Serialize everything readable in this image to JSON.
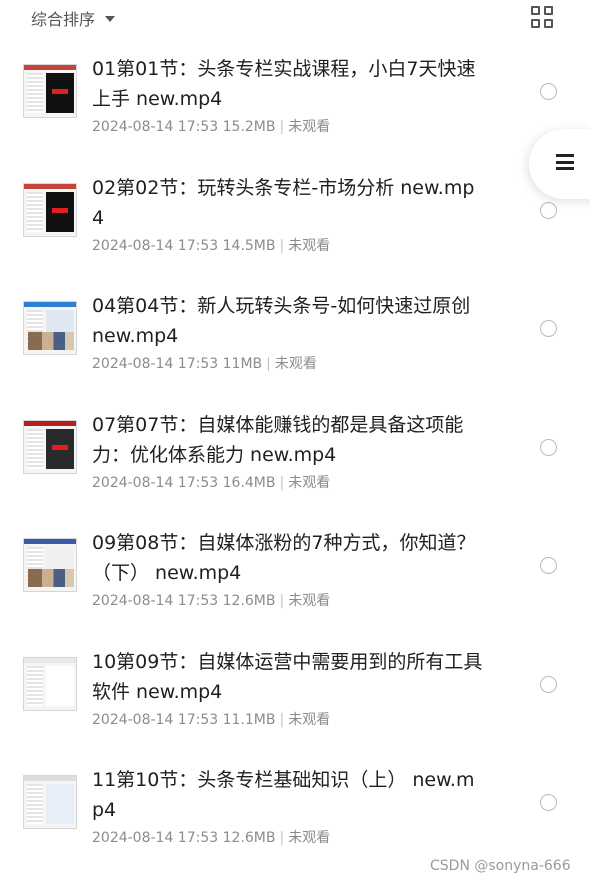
{
  "toolbar": {
    "sort_label": "综合排序",
    "sort_icon": "caret-down-icon",
    "view_toggle_icon": "grid-view-icon"
  },
  "floating_menu": {
    "icon": "menu-icon"
  },
  "files": [
    {
      "title": "01第01节：头条专栏实战课程，小白7天快速上手 new.mp4",
      "date": "2024-08-14 17:53",
      "size": "15.2MB",
      "status": "未观看",
      "thumb": "dark"
    },
    {
      "title": "02第02节：玩转头条专栏-市场分析 new.mp4",
      "date": "2024-08-14 17:53",
      "size": "14.5MB",
      "status": "未观看",
      "thumb": "dark"
    },
    {
      "title": "04第04节：新人玩转头条号-如何快速过原创 new.mp4",
      "date": "2024-08-14 17:53",
      "size": "11MB",
      "status": "未观看",
      "thumb": "web"
    },
    {
      "title": "07第07节：自媒体能赚钱的都是具备这项能力：优化体系能力 new.mp4",
      "date": "2024-08-14 17:53",
      "size": "16.4MB",
      "status": "未观看",
      "thumb": "red"
    },
    {
      "title": "09第08节：自媒体涨粉的7种方式，你知道？（下） new.mp4",
      "date": "2024-08-14 17:53",
      "size": "12.6MB",
      "status": "未观看",
      "thumb": "photo"
    },
    {
      "title": "10第09节：自媒体运营中需要用到的所有工具软件 new.mp4",
      "date": "2024-08-14 17:53",
      "size": "11.1MB",
      "status": "未观看",
      "thumb": "doc"
    },
    {
      "title": "11第10节：头条专栏基础知识（上） new.mp4",
      "date": "2024-08-14 17:53",
      "size": "12.6MB",
      "status": "未观看",
      "thumb": "diagram"
    }
  ],
  "watermark": "CSDN @sonyna-666"
}
